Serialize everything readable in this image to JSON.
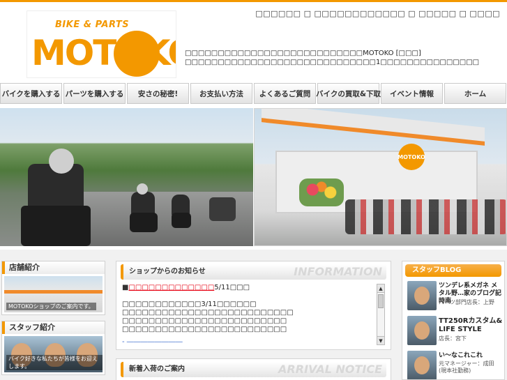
{
  "header": {
    "logo": {
      "tagline": "BIKE & PARTS",
      "name": "MOTOKO"
    },
    "util_links": "□□□□□□ □ □□□□□□□□□□□□ □ □□□□□ □ □□□□",
    "desc_line1": "□□□□□□□□□□□□□□□□□□□□□□□□□□□MOTOKO [□□□]",
    "desc_line2": "□□□□□□□□□□□□□□□□□□□□□□□□□□□□□1□□□□□□□□□□□□□□□"
  },
  "nav": [
    "バイクを購入する",
    "パーツを購入する",
    "安さの秘密!",
    "お支払い方法",
    "よくあるご質問",
    "バイクの買取&下取",
    "イベント情報",
    "ホーム"
  ],
  "sidebar": {
    "shop": {
      "title": "店舗紹介",
      "caption": "MOTOKOショップのご案内です。"
    },
    "staff": {
      "title": "スタッフ紹介",
      "caption": "バイク好きな私たちが皆様をお迎えします。"
    }
  },
  "news": {
    "title": "ショップからのお知らせ",
    "title_en": "INFORMATION",
    "item_marker": "■",
    "item_link": "□□□□□□□□□□□□□",
    "item_date": "5/11□□□",
    "body": [
      "□□□□□□□□□□□□3/11□□□□□□",
      "□□□□□□□□□□□□□□□□□□□□□□□□□□",
      "□□□□□□□□□□□□□□□□□□□□□□□□□",
      "□□□□□□□□□□□□□□□□□□□□□□□□□"
    ],
    "more": "- ――――――――"
  },
  "arrival": {
    "title": "新着入荷のご案内",
    "title_en": "ARRIVAL NOTICE"
  },
  "blog": {
    "title": "スタッフBLOG",
    "items": [
      {
        "title": "ツンデレ系メガネ メタル野…家のブログ記時南",
        "sub": "パーツ部門店長：上野"
      },
      {
        "title": "TT250Rカスタム& LIFE STYLE",
        "sub": "店長：宮下"
      },
      {
        "title": "い～なこれこれ",
        "sub": "元マネージャー：成田 (現本社勤務)"
      }
    ]
  },
  "colors": {
    "accent": "#f39800",
    "link_red": "#e60012"
  }
}
